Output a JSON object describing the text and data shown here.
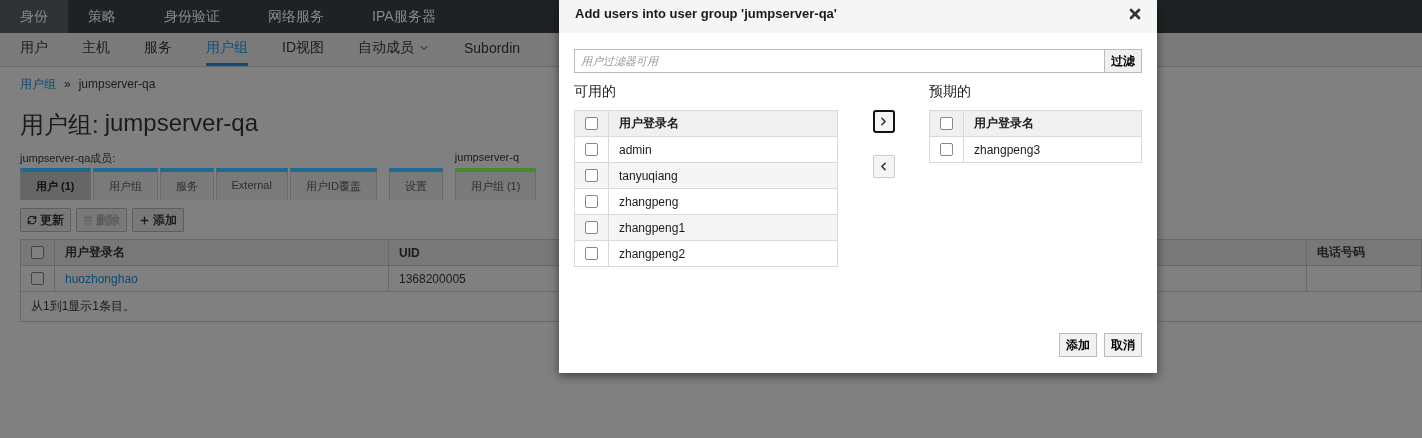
{
  "top_nav": [
    {
      "label": "身份",
      "selected": true
    },
    {
      "label": "策略",
      "selected": false
    },
    {
      "label": "身份验证",
      "selected": false
    },
    {
      "label": "网络服务",
      "selected": false
    },
    {
      "label": "IPA服务器",
      "selected": false
    }
  ],
  "sub_nav": [
    {
      "label": "用户",
      "selected": false,
      "has_menu": false
    },
    {
      "label": "主机",
      "selected": false,
      "has_menu": false
    },
    {
      "label": "服务",
      "selected": false,
      "has_menu": false
    },
    {
      "label": "用户组",
      "selected": true,
      "has_menu": false
    },
    {
      "label": "ID视图",
      "selected": false,
      "has_menu": false
    },
    {
      "label": "自动成员",
      "selected": false,
      "has_menu": true
    },
    {
      "label": "Subordin",
      "selected": false,
      "has_menu": false
    }
  ],
  "breadcrumb": {
    "link": "用户组",
    "separator": "»",
    "current": "jumpserver-qa"
  },
  "page_title": {
    "prefix": "用户组:",
    "name": "jumpserver-qa"
  },
  "sections": [
    {
      "label": "jumpserver-qa成员:",
      "color": "#1e6a91",
      "tabs": [
        {
          "label": "用户 (1)",
          "selected": true
        },
        {
          "label": "用户组",
          "selected": false
        },
        {
          "label": "服务",
          "selected": false
        },
        {
          "label": "External",
          "selected": false
        },
        {
          "label": "用户ID覆盖",
          "selected": false
        }
      ]
    },
    {
      "color": "#1e6a91",
      "tabs": [
        {
          "label": "设置",
          "selected": false
        }
      ]
    },
    {
      "label": "jumpserver-q",
      "color": "#4a8a2e",
      "tabs": [
        {
          "label": "用户组 (1)",
          "selected": false
        }
      ]
    }
  ],
  "toolbar": [
    {
      "kind": "refresh",
      "label": "更新",
      "disabled": false
    },
    {
      "kind": "delete",
      "label": "删除",
      "disabled": true
    },
    {
      "kind": "add",
      "label": "添加",
      "disabled": false
    }
  ],
  "table": {
    "all_checked": false,
    "columns": [
      "用户登录名",
      "UID",
      "电话号码"
    ],
    "rows": [
      {
        "checked": false,
        "login": "huozhonghao",
        "uid": "1368200005"
      }
    ],
    "footer": "从1到1显示1条目。"
  },
  "dialog": {
    "title": "Add users into user group 'jumpserver-qa'",
    "filter": {
      "placeholder": "用户过滤器可用",
      "button": "过滤"
    },
    "available": {
      "heading": "可用的",
      "column": "用户登录名",
      "all_checked": false,
      "rows": [
        {
          "name": "admin",
          "checked": false
        },
        {
          "name": "tanyuqiang",
          "checked": false
        },
        {
          "name": "zhangpeng",
          "checked": false
        },
        {
          "name": "zhangpeng1",
          "checked": false
        },
        {
          "name": "zhangpeng2",
          "checked": false
        }
      ]
    },
    "move_buttons": [
      {
        "kind": "right",
        "focused": true
      },
      {
        "kind": "left",
        "focused": false
      }
    ],
    "expected": {
      "heading": "预期的",
      "column": "用户登录名",
      "all_checked": false,
      "rows": [
        {
          "name": "zhangpeng3",
          "checked": false
        }
      ]
    },
    "footer_buttons": [
      "添加",
      "取消"
    ]
  }
}
